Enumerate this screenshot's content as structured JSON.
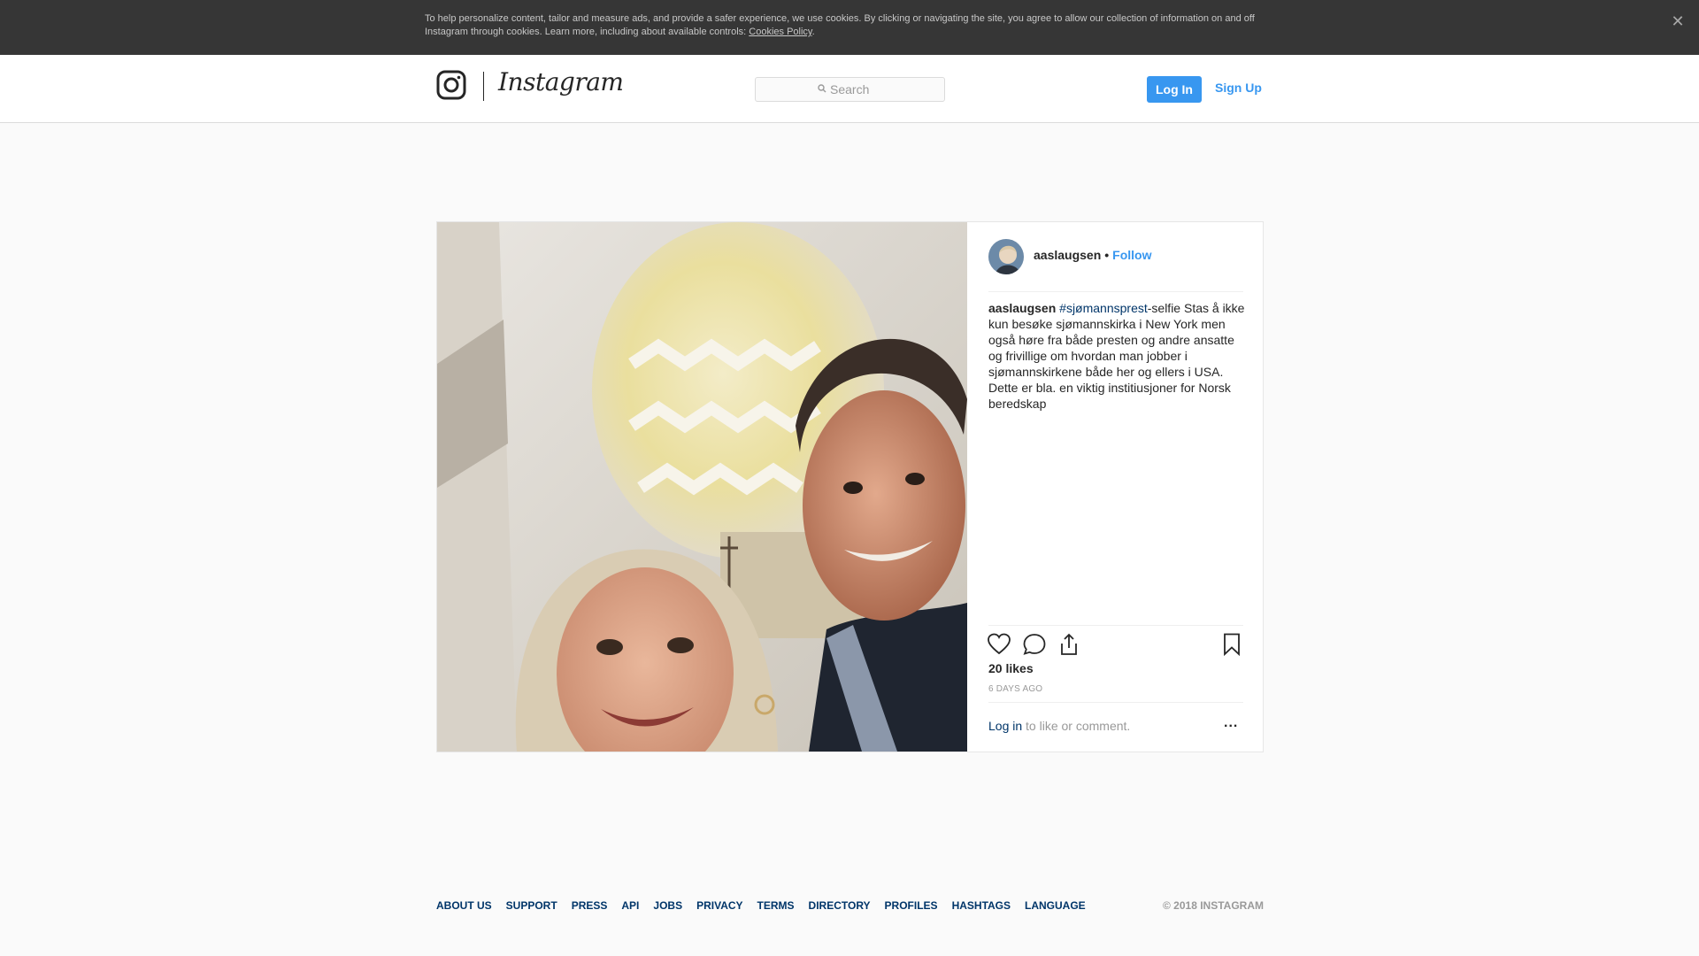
{
  "cookie_banner": {
    "text": "To help personalize content, tailor and measure ads, and provide a safer experience, we use cookies. By clicking or navigating the site, you agree to allow our collection of information on and off Instagram through cookies. Learn more, including about available controls: ",
    "link": "Cookies Policy",
    "suffix": ".",
    "close_icon": "close-icon"
  },
  "nav": {
    "brand": "Instagram",
    "search_placeholder": "Search",
    "login_label": "Log In",
    "signup_label": "Sign Up"
  },
  "post": {
    "username": "aaslaugsen",
    "separator": "•",
    "follow_label": "Follow",
    "caption": {
      "username": "aaslaugsen",
      "hashtag": "#sjømannsprest",
      "text": "-selfie⁣  Stas å ikke kun besøke sjømannskirka i New York men også høre fra både presten og andre ansatte og frivillige om hvordan man jobber i sjømannskirkene både her og ellers i USA. Dette er bla. en viktig institiusjoner for Norsk beredskap⁣"
    },
    "likes": "20 likes",
    "time_ago": "6 DAYS AGO",
    "comment_login": "Log in",
    "comment_text": " to like or comment.",
    "icons": [
      "heart-icon",
      "comment-icon",
      "share-icon",
      "bookmark-icon",
      "more-options-icon"
    ]
  },
  "footer": {
    "links": [
      "ABOUT US",
      "SUPPORT",
      "PRESS",
      "API",
      "JOBS",
      "PRIVACY",
      "TERMS",
      "DIRECTORY",
      "PROFILES",
      "HASHTAGS",
      "LANGUAGE"
    ],
    "copyright": "© 2018 INSTAGRAM"
  },
  "colors": {
    "accent": "#3897f0",
    "link_dark": "#003569",
    "banner": "#363636"
  }
}
